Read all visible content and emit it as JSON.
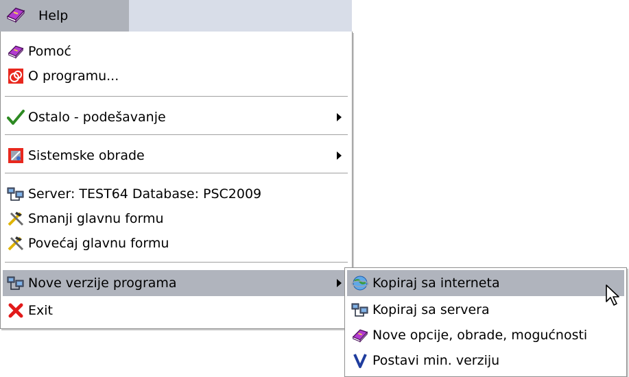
{
  "menubar": {
    "help_label": "Help",
    "help_icon": "book-icon"
  },
  "main_menu": {
    "items": [
      {
        "label": "Pomoć",
        "icon": "book-icon"
      },
      {
        "label": "O programu...",
        "icon": "about-logo-icon"
      },
      {
        "label": "Ostalo - podešavanje",
        "icon": "checkmark-icon",
        "has_submenu": true
      },
      {
        "label": "Sistemske obrade",
        "icon": "system-tools-icon",
        "has_submenu": true
      },
      {
        "label": "Server: TEST64  Database: PSC2009",
        "icon": "network-computers-icon"
      },
      {
        "label": "Smanji glavnu formu",
        "icon": "hammer-tools-icon"
      },
      {
        "label": "Povećaj glavnu formu",
        "icon": "hammer-tools-icon"
      },
      {
        "label": "Nove verzije programa",
        "icon": "network-computers-icon",
        "has_submenu": true,
        "highlighted": true
      },
      {
        "label": "Exit",
        "icon": "red-x-icon"
      }
    ]
  },
  "sub_menu": {
    "items": [
      {
        "label": "Kopiraj sa interneta",
        "icon": "internet-globe-icon",
        "highlighted": true
      },
      {
        "label": "Kopiraj sa servera",
        "icon": "network-computers-icon"
      },
      {
        "label": "Nove opcije, obrade, mogućnosti",
        "icon": "book-icon"
      },
      {
        "label": "Postavi min. verziju",
        "icon": "v-letter-icon"
      }
    ]
  },
  "colors": {
    "menubar_bg": "#d8dde8",
    "highlight": "#b0b4bd",
    "exit_red": "#e21a1a",
    "check_green": "#2d8a22"
  }
}
